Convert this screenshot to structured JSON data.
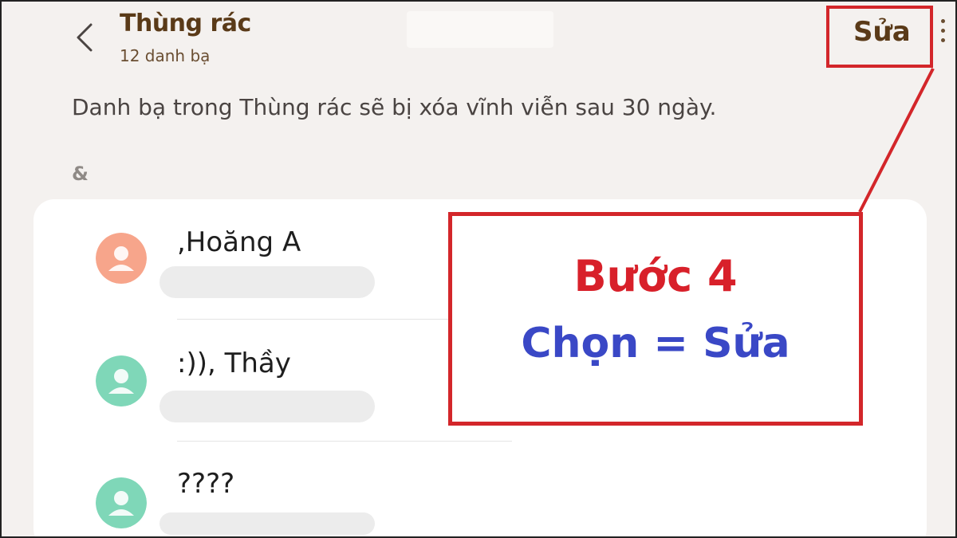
{
  "header": {
    "title": "Thùng rác",
    "subtitle": "12 danh bạ",
    "edit_label": "Sửa"
  },
  "icons": {
    "back": "back-arrow-icon",
    "more": "more-vertical-icon",
    "avatar": "person-icon"
  },
  "notice": "Danh bạ trong Thùng rác sẽ bị xóa vĩnh viễn sau 30 ngày.",
  "section_header": "&",
  "contacts": [
    {
      "name": ",Hoăng A",
      "avatar_color": "#f7a58b"
    },
    {
      "name": ":)), Thầy",
      "avatar_color": "#7fd7b8"
    },
    {
      "name": "????",
      "avatar_color": "#7fd7b8"
    }
  ],
  "annotation": {
    "step": "Bước 4",
    "action": "Chọn = Sửa",
    "border_color": "#d3262a",
    "step_color": "#d8202a",
    "action_color": "#3a48c6"
  }
}
